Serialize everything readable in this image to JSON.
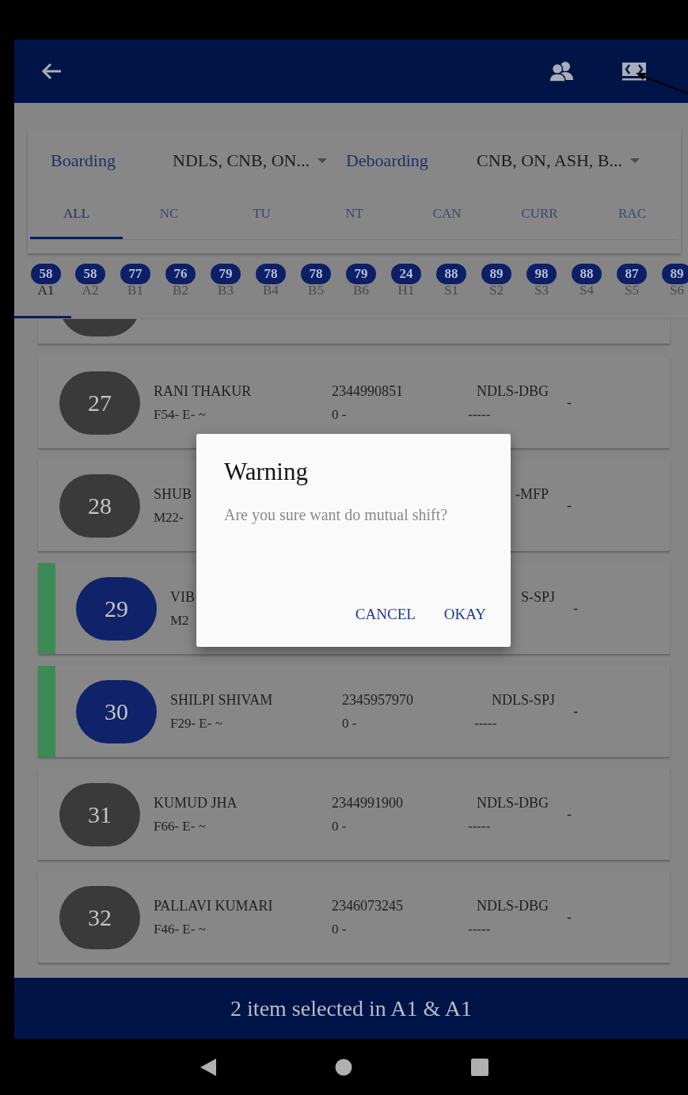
{
  "filters": {
    "boarding": {
      "label": "Boarding",
      "value": "NDLS, CNB, ON..."
    },
    "deboarding": {
      "label": "Deboarding",
      "value": "CNB, ON, ASH, B..."
    }
  },
  "tabs": [
    {
      "label": "ALL",
      "selected": true
    },
    {
      "label": "NC",
      "selected": false
    },
    {
      "label": "TU",
      "selected": false
    },
    {
      "label": "NT",
      "selected": false
    },
    {
      "label": "CAN",
      "selected": false
    },
    {
      "label": "CURR",
      "selected": false
    },
    {
      "label": "RAC",
      "selected": false
    }
  ],
  "coaches": [
    {
      "count": "58",
      "label": "A1",
      "selected": true
    },
    {
      "count": "58",
      "label": "A2",
      "selected": false
    },
    {
      "count": "77",
      "label": "B1",
      "selected": false
    },
    {
      "count": "76",
      "label": "B2",
      "selected": false
    },
    {
      "count": "79",
      "label": "B3",
      "selected": false
    },
    {
      "count": "78",
      "label": "B4",
      "selected": false
    },
    {
      "count": "78",
      "label": "B5",
      "selected": false
    },
    {
      "count": "79",
      "label": "B6",
      "selected": false
    },
    {
      "count": "24",
      "label": "H1",
      "selected": false
    },
    {
      "count": "88",
      "label": "S1",
      "selected": false
    },
    {
      "count": "89",
      "label": "S2",
      "selected": false
    },
    {
      "count": "98",
      "label": "S3",
      "selected": false
    },
    {
      "count": "88",
      "label": "S4",
      "selected": false
    },
    {
      "count": "87",
      "label": "S5",
      "selected": false
    },
    {
      "count": "89",
      "label": "S6",
      "selected": false
    }
  ],
  "passengers": [
    {
      "seat": "27",
      "name": "RANI THAKUR",
      "detail": "F54- E- ~",
      "phone": "2344990851",
      "phone_sub": "0 -",
      "route": "NDLS-DBG",
      "route_sub": "-----",
      "extra": "-",
      "selected": false
    },
    {
      "seat": "28",
      "name": "SHUB",
      "detail": "M22-",
      "route": "-MFP",
      "extra": "-",
      "selected": false
    },
    {
      "seat": "29",
      "name": "VIB",
      "detail": "M2",
      "route": "S-SPJ",
      "extra": "-",
      "selected": true
    },
    {
      "seat": "30",
      "name": "SHILPI SHIVAM",
      "detail": "F29- E- ~",
      "phone": "2345957970",
      "phone_sub": "0 -",
      "route": "NDLS-SPJ",
      "route_sub": "-----",
      "extra": "-",
      "selected": true
    },
    {
      "seat": "31",
      "name": "KUMUD JHA",
      "detail": "F66- E- ~",
      "phone": "2344991900",
      "phone_sub": "0 -",
      "route": "NDLS-DBG",
      "route_sub": "-----",
      "extra": "-",
      "selected": false
    },
    {
      "seat": "32",
      "name": "PALLAVI KUMARI",
      "detail": "F46- E- ~",
      "phone": "2346073245",
      "phone_sub": "0 -",
      "route": "NDLS-DBG",
      "route_sub": "-----",
      "extra": "-",
      "selected": false
    }
  ],
  "selection_bar": {
    "text": "2 item selected in A1 & A1"
  },
  "dialog": {
    "title": "Warning",
    "message": "Are you sure want do mutual shift?",
    "buttons": [
      "CANCEL",
      "OKAY"
    ]
  }
}
